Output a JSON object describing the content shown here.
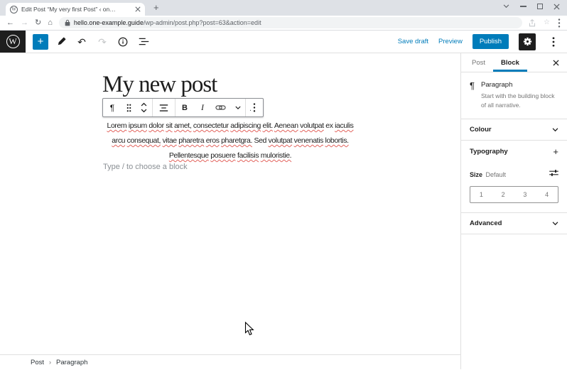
{
  "browser": {
    "tab_title": "Edit Post “My very first Post” ‹ on…",
    "url": {
      "domain": "hello.one-example.guide",
      "path": "/wp-admin/post.php?post=63&action=edit"
    }
  },
  "wp_header": {
    "save_draft": "Save draft",
    "preview": "Preview",
    "publish": "Publish"
  },
  "icons": {
    "wp_logo": "W",
    "favicon": "W",
    "new_tab": "+",
    "back": "←",
    "forward": "→",
    "reload": "↻",
    "home": "⌂",
    "star": "☆",
    "add_block": "+",
    "undo": "↶",
    "redo": "↷",
    "paragraph": "¶",
    "bold": "B",
    "italic": "I",
    "typography_add": "+",
    "breadcrumb_sep": "›"
  },
  "canvas": {
    "post_title": "My new post",
    "placeholder": "Type / to choose a block",
    "artifact": ".",
    "paragraph_lines": [
      [
        {
          "t": "Lorem",
          "m": true
        },
        {
          "t": "ipsum",
          "m": true
        },
        {
          "t": "dolor",
          "m": true
        },
        {
          "t": "sit",
          "m": true
        },
        {
          "t": "amet,",
          "m": true
        },
        {
          "t": "consectetur",
          "m": true
        },
        {
          "t": "adipiscing",
          "m": true
        },
        {
          "t": "elit.",
          "m": true
        },
        {
          "t": "Aenean",
          "m": true
        },
        {
          "t": "volutpat",
          "m": true
        },
        {
          "t": "ex",
          "m": false
        },
        {
          "t": "iaculis",
          "m": true
        }
      ],
      [
        {
          "t": "arcu",
          "m": true
        },
        {
          "t": "consequat,",
          "m": true
        },
        {
          "t": "vitae",
          "m": true
        },
        {
          "t": "pharetra",
          "m": true
        },
        {
          "t": "eros",
          "m": true
        },
        {
          "t": "pharetgra.",
          "m": true
        },
        {
          "t": "Sed",
          "m": false
        },
        {
          "t": "volutpat",
          "m": true
        },
        {
          "t": "venenatis",
          "m": true
        },
        {
          "t": "lobortis.",
          "m": true
        }
      ],
      [
        {
          "t": "Pellentesque",
          "m": true
        },
        {
          "t": "posuere",
          "m": true
        },
        {
          "t": "facilisis",
          "m": true
        },
        {
          "t": "muloristie.",
          "m": true
        }
      ]
    ]
  },
  "sidebar": {
    "tabs": {
      "post": "Post",
      "block": "Block"
    },
    "block_card": {
      "name": "Paragraph",
      "description": "Start with the building block of all narrative."
    },
    "panels": {
      "colour": "Colour",
      "typography": "Typography",
      "advanced": "Advanced"
    },
    "size": {
      "label": "Size",
      "value": "Default",
      "options": [
        "1",
        "2",
        "3",
        "4"
      ]
    }
  },
  "footer": {
    "breadcrumb": [
      "Post",
      "Paragraph"
    ]
  },
  "colors": {
    "accent": "#007cba",
    "dark": "#1e1e1e",
    "muted": "#757575",
    "spellcheck": "#e2635d"
  }
}
